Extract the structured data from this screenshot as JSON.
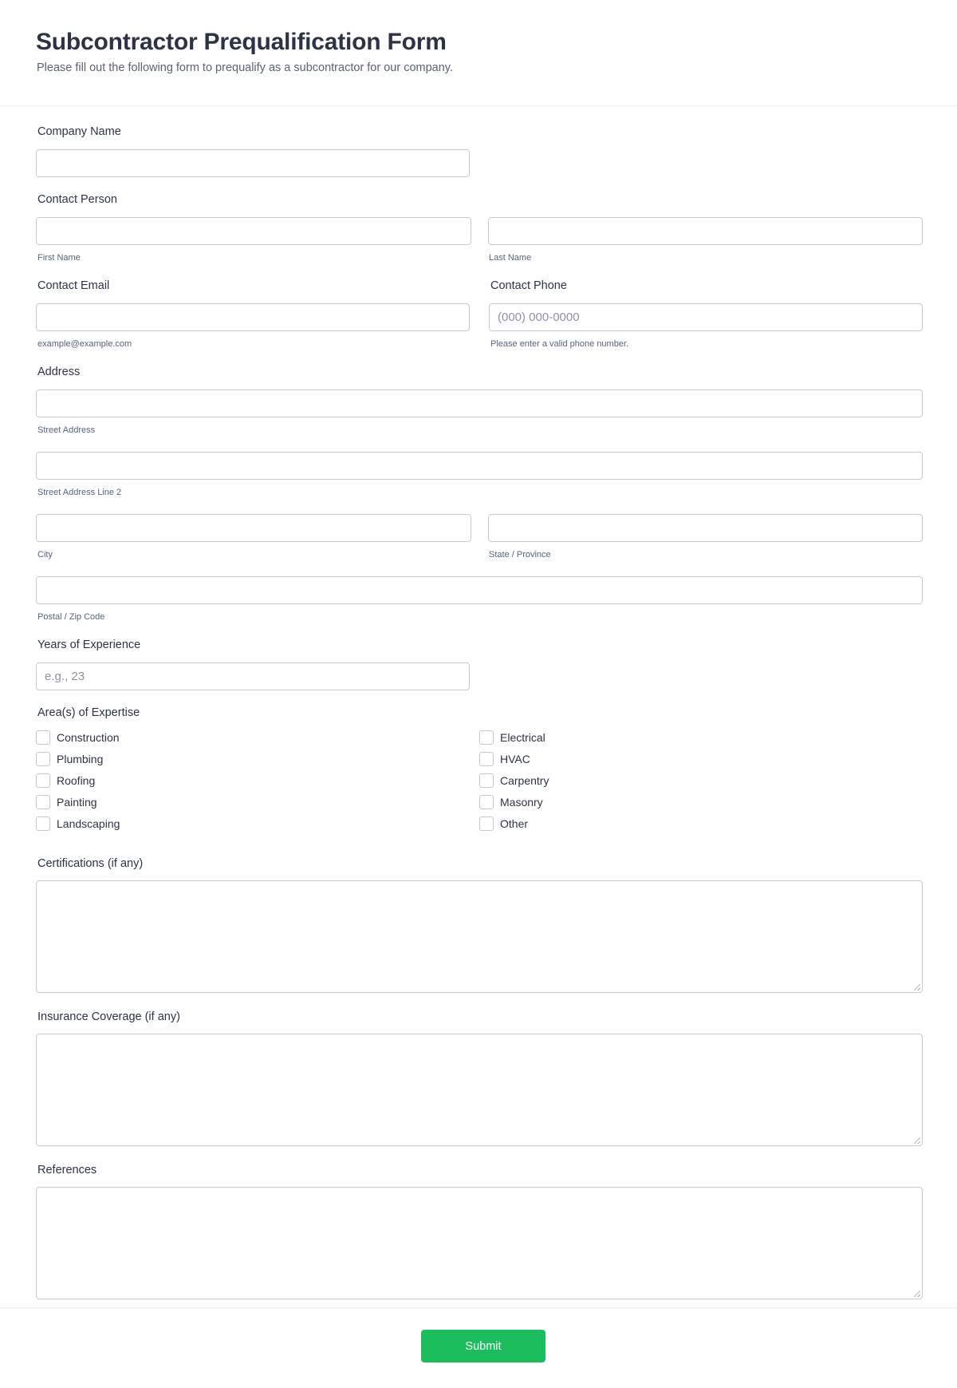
{
  "header": {
    "title": "Subcontractor Prequalification Form",
    "subtitle": "Please fill out the following form to prequalify as a subcontractor for our company."
  },
  "fields": {
    "company_name": {
      "label": "Company Name",
      "value": "",
      "placeholder": ""
    },
    "contact_person": {
      "label": "Contact Person",
      "first_name": {
        "value": "",
        "placeholder": "",
        "sublabel": "First Name"
      },
      "last_name": {
        "value": "",
        "placeholder": "",
        "sublabel": "Last Name"
      }
    },
    "contact_email": {
      "label": "Contact Email",
      "value": "",
      "placeholder": "",
      "sublabel": "example@example.com"
    },
    "contact_phone": {
      "label": "Contact Phone",
      "value": "",
      "placeholder": "(000) 000-0000",
      "sublabel": "Please enter a valid phone number."
    },
    "address": {
      "label": "Address",
      "street": {
        "value": "",
        "sublabel": "Street Address"
      },
      "street2": {
        "value": "",
        "sublabel": "Street Address Line 2"
      },
      "city": {
        "value": "",
        "sublabel": "City"
      },
      "state": {
        "value": "",
        "sublabel": "State / Province"
      },
      "postal": {
        "value": "",
        "sublabel": "Postal / Zip Code"
      }
    },
    "years_experience": {
      "label": "Years of Experience",
      "value": "",
      "placeholder": "e.g., 23"
    },
    "expertise": {
      "label": "Area(s) of Expertise",
      "options": [
        {
          "label": "Construction",
          "checked": false
        },
        {
          "label": "Plumbing",
          "checked": false
        },
        {
          "label": "Roofing",
          "checked": false
        },
        {
          "label": "Painting",
          "checked": false
        },
        {
          "label": "Landscaping",
          "checked": false
        },
        {
          "label": "Electrical",
          "checked": false
        },
        {
          "label": "HVAC",
          "checked": false
        },
        {
          "label": "Carpentry",
          "checked": false
        },
        {
          "label": "Masonry",
          "checked": false
        },
        {
          "label": "Other",
          "checked": false
        }
      ]
    },
    "certifications": {
      "label": "Certifications (if any)",
      "value": ""
    },
    "insurance": {
      "label": "Insurance Coverage (if any)",
      "value": ""
    },
    "references": {
      "label": "References",
      "value": ""
    }
  },
  "footer": {
    "submit_label": "Submit"
  },
  "colors": {
    "accent": "#1bbd5c",
    "text": "#2c3345",
    "border": "#c7cbd6"
  }
}
